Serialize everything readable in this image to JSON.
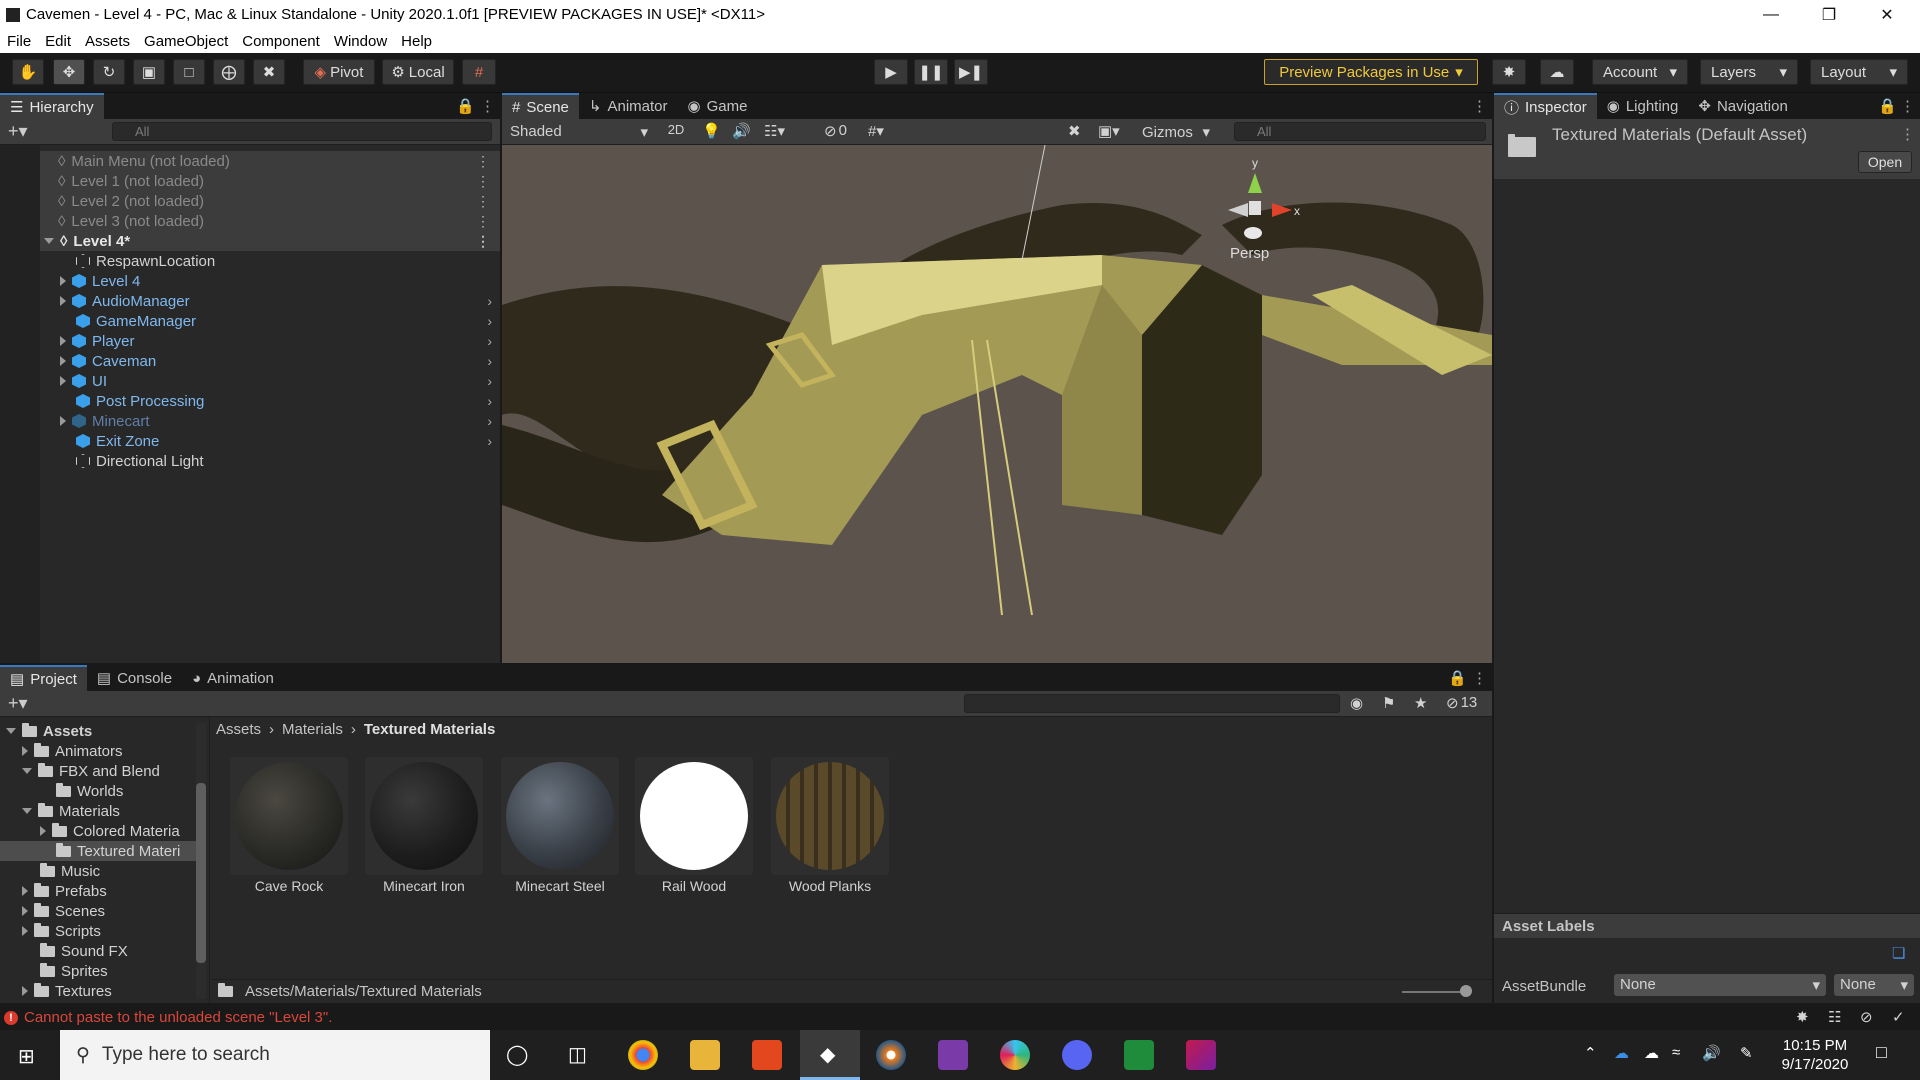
{
  "window": {
    "title": "Cavemen - Level 4 - PC, Mac & Linux Standalone - Unity 2020.1.0f1 [PREVIEW PACKAGES IN USE]* <DX11>"
  },
  "menu": [
    "File",
    "Edit",
    "Assets",
    "GameObject",
    "Component",
    "Window",
    "Help"
  ],
  "toolbar": {
    "pivot": "Pivot",
    "local": "Local",
    "preview_packages": "Preview Packages in Use",
    "account": "Account",
    "layers": "Layers",
    "layout": "Layout"
  },
  "hierarchy": {
    "tab": "Hierarchy",
    "search_placeholder": "All",
    "scenes": [
      {
        "label": "Main Menu (not loaded)"
      },
      {
        "label": "Level 1 (not loaded)"
      },
      {
        "label": "Level 2 (not loaded)"
      },
      {
        "label": "Level 3 (not loaded)"
      },
      {
        "label": "Level 4*"
      }
    ],
    "items": [
      {
        "label": "RespawnLocation"
      },
      {
        "label": "Level 4"
      },
      {
        "label": "AudioManager"
      },
      {
        "label": "GameManager"
      },
      {
        "label": "Player"
      },
      {
        "label": "Caveman"
      },
      {
        "label": "UI"
      },
      {
        "label": "Post Processing"
      },
      {
        "label": "Minecart"
      },
      {
        "label": "Exit Zone"
      },
      {
        "label": "Directional Light"
      }
    ]
  },
  "scene": {
    "tabs": [
      "Scene",
      "Animator",
      "Game"
    ],
    "shading": "Shaded",
    "mode_2d": "2D",
    "hidden_count": "0",
    "gizmos": "Gizmos",
    "search_placeholder": "All",
    "axis_y": "y",
    "axis_x": "x",
    "persp": "Persp"
  },
  "inspector": {
    "tabs": [
      "Inspector",
      "Lighting",
      "Navigation"
    ],
    "asset_title": "Textured Materials (Default Asset)",
    "open_button": "Open",
    "asset_labels": "Asset Labels",
    "assetbundle_label": "AssetBundle",
    "bundle_value": "None",
    "variant_value": "None"
  },
  "project": {
    "tabs": [
      "Project",
      "Console",
      "Animation"
    ],
    "hidden_count": "13",
    "tree": [
      {
        "label": "Assets"
      },
      {
        "label": "Animators"
      },
      {
        "label": "FBX and Blend"
      },
      {
        "label": "Worlds"
      },
      {
        "label": "Materials"
      },
      {
        "label": "Colored Materia"
      },
      {
        "label": "Textured Materi"
      },
      {
        "label": "Music"
      },
      {
        "label": "Prefabs"
      },
      {
        "label": "Scenes"
      },
      {
        "label": "Scripts"
      },
      {
        "label": "Sound FX"
      },
      {
        "label": "Sprites"
      },
      {
        "label": "Textures"
      }
    ],
    "breadcrumb": [
      "Assets",
      "Materials",
      "Textured Materials"
    ],
    "materials": [
      {
        "label": "Cave Rock",
        "color": "#2a2a27"
      },
      {
        "label": "Minecart Iron",
        "color": "#1e1e1e"
      },
      {
        "label": "Minecart Steel",
        "color": "#3a4048"
      },
      {
        "label": "Rail Wood",
        "color": "#ffffff"
      },
      {
        "label": "Wood Planks",
        "color": "#4a3f28"
      }
    ],
    "path": "Assets/Materials/Textured Materials"
  },
  "status": {
    "message": "Cannot paste to the unloaded scene \"Level 3\"."
  },
  "taskbar": {
    "search_placeholder": "Type here to search",
    "time": "10:15 PM",
    "date": "9/17/2020"
  }
}
